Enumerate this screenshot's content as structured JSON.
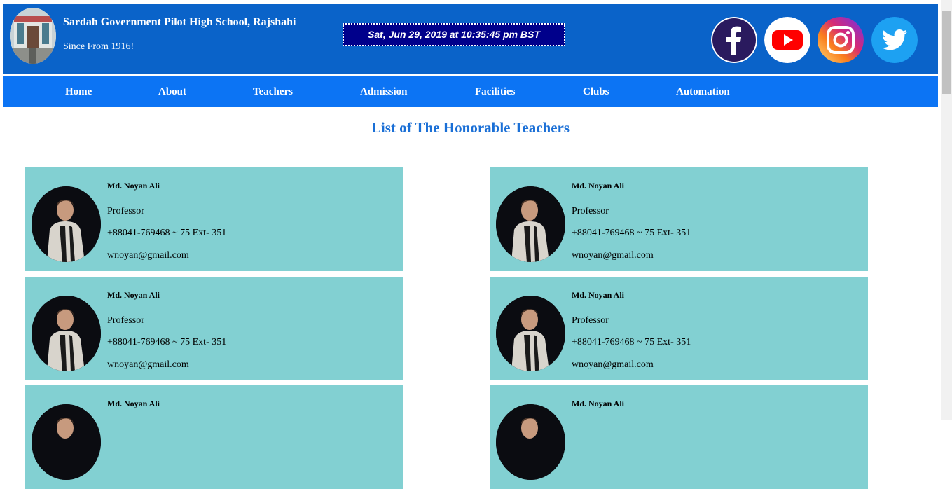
{
  "header": {
    "school_name": "Sardah Government Pilot High School, Rajshahi",
    "since": "Since From 1916!",
    "datetime": "Sat, Jun 29, 2019 at 10:35:45 pm BST",
    "social": [
      {
        "icon": "facebook-icon",
        "color": "#2a1a5e"
      },
      {
        "icon": "youtube-icon",
        "color": "#ff0000"
      },
      {
        "icon": "instagram-icon",
        "color": "#c13584"
      },
      {
        "icon": "twitter-icon",
        "color": "#1da1f2"
      }
    ]
  },
  "nav": {
    "items": [
      "Home",
      "About",
      "Teachers",
      "Admission",
      "Facilities",
      "Clubs",
      "Automation"
    ]
  },
  "page": {
    "title": "List of The Honorable Teachers"
  },
  "teachers": [
    {
      "name": "Md. Noyan Ali",
      "title": "Professor",
      "phone": "+88041-769468 ~ 75 Ext- 351",
      "email": "wnoyan@gmail.com"
    },
    {
      "name": "Md. Noyan Ali",
      "title": "Professor",
      "phone": "+88041-769468 ~ 75 Ext- 351",
      "email": "wnoyan@gmail.com"
    },
    {
      "name": "Md. Noyan Ali",
      "title": "Professor",
      "phone": "+88041-769468 ~ 75 Ext- 351",
      "email": "wnoyan@gmail.com"
    },
    {
      "name": "Md. Noyan Ali",
      "title": "Professor",
      "phone": "+88041-769468 ~ 75 Ext- 351",
      "email": "wnoyan@gmail.com"
    },
    {
      "name": "Md. Noyan Ali",
      "title": "",
      "phone": "",
      "email": ""
    },
    {
      "name": "Md. Noyan Ali",
      "title": "",
      "phone": "",
      "email": ""
    }
  ],
  "colors": {
    "header_bg": "#0a63c9",
    "nav_bg": "#0c74f4",
    "card_bg": "#82d0d2",
    "title_color": "#1a6fd6",
    "clock_bg": "#00008b"
  }
}
